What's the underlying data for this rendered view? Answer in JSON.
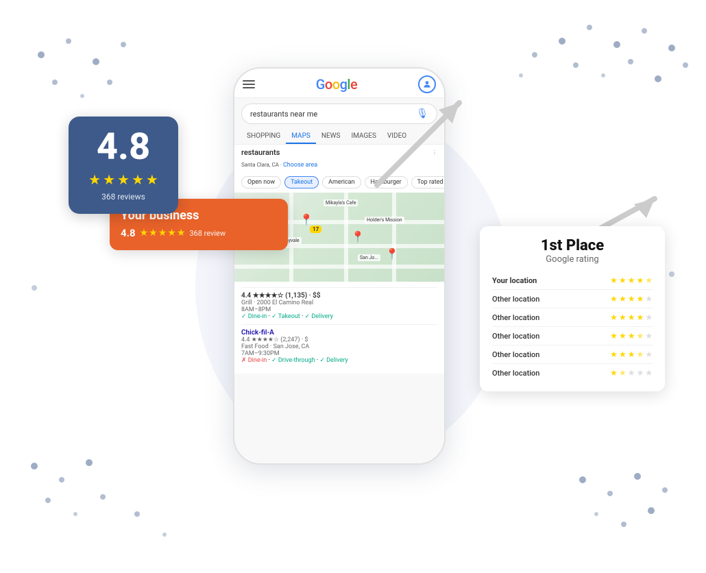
{
  "scene": {
    "background": "#ffffff"
  },
  "rating_badge": {
    "number": "4.8",
    "reviews": "368 reviews",
    "stars": [
      "full",
      "full",
      "full",
      "full",
      "half"
    ]
  },
  "your_business": {
    "title": "Your business",
    "rating": "4.8",
    "review_count": "368 review",
    "stars": [
      "full",
      "full",
      "full",
      "full",
      "half"
    ]
  },
  "first_place": {
    "title": "1st Place",
    "subtitle": "Google rating",
    "locations": [
      {
        "name": "Your location",
        "bold": true,
        "stars": [
          "full",
          "full",
          "full",
          "full",
          "half"
        ]
      },
      {
        "name": "Other location",
        "bold": false,
        "stars": [
          "full",
          "full",
          "full",
          "full",
          "empty"
        ]
      },
      {
        "name": "Other location",
        "bold": false,
        "stars": [
          "full",
          "full",
          "full",
          "full",
          "empty"
        ]
      },
      {
        "name": "Other location",
        "bold": false,
        "stars": [
          "full",
          "full",
          "full",
          "half",
          "empty"
        ]
      },
      {
        "name": "Other location",
        "bold": false,
        "stars": [
          "full",
          "full",
          "full",
          "half",
          "empty"
        ]
      },
      {
        "name": "Other location",
        "bold": false,
        "stars": [
          "full",
          "half",
          "empty",
          "empty",
          "empty"
        ]
      }
    ]
  },
  "google_ui": {
    "search_text": "restaurants near me",
    "location": "Santa Clara, CA · Choose area",
    "tabs": [
      "SHOPPING",
      "MAPS",
      "NEWS",
      "IMAGES",
      "VIDEO"
    ],
    "active_tab": "MAPS",
    "chips": [
      "Open now",
      "Takeout",
      "American",
      "Hamburger",
      "Top rated"
    ],
    "result1": {
      "name": "Chick-fil-A",
      "rating": "4.4",
      "reviews": "(2,247)",
      "type": "Fast Food · San Jose, CA",
      "hours": "7AM–9:30PM",
      "price": "$",
      "options": [
        "× Dine-in",
        "✓ Drive-through",
        "✓ Delivery"
      ]
    }
  },
  "icons": {
    "hamburger": "☰",
    "mic": "🎤",
    "user": "👤",
    "star_full": "★",
    "star_half": "⯨",
    "star_empty": "☆",
    "arrow_up_right": "↗"
  }
}
